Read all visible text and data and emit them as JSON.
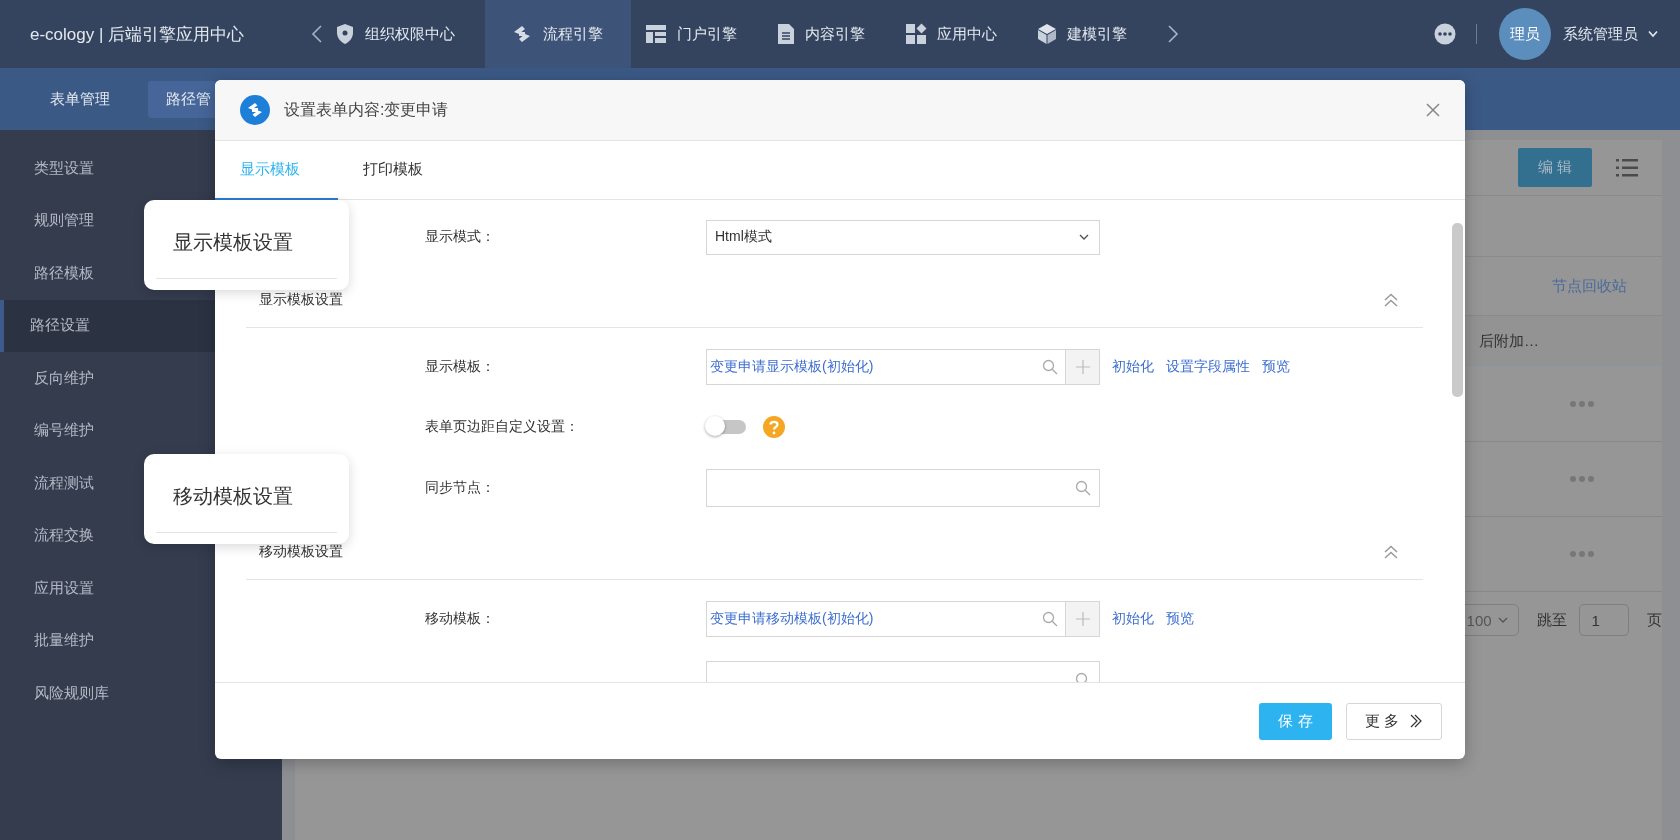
{
  "app": {
    "title": "e-cology | 后端引擎应用中心"
  },
  "top_nav": [
    {
      "label": "组织权限中心",
      "selected": false
    },
    {
      "label": "流程引擎",
      "selected": true
    },
    {
      "label": "门户引擎",
      "selected": false
    },
    {
      "label": "内容引擎",
      "selected": false
    },
    {
      "label": "应用中心",
      "selected": false
    },
    {
      "label": "建模引擎",
      "selected": false
    }
  ],
  "user": {
    "avatar_text": "理员",
    "name": "系统管理员"
  },
  "sub_nav": [
    {
      "label": "表单管理",
      "selected": false
    },
    {
      "label": "路径管",
      "selected": true
    }
  ],
  "sidebar": {
    "items": [
      {
        "label": "类型设置",
        "selected": false
      },
      {
        "label": "规则管理",
        "selected": false
      },
      {
        "label": "路径模板",
        "selected": false
      },
      {
        "label": "路径设置",
        "selected": true
      },
      {
        "label": "反向维护",
        "selected": false
      },
      {
        "label": "编号维护",
        "selected": false
      },
      {
        "label": "流程测试",
        "selected": false
      },
      {
        "label": "流程交换",
        "selected": false
      },
      {
        "label": "应用设置",
        "selected": false
      },
      {
        "label": "批量维护",
        "selected": false
      },
      {
        "label": "风险规则库",
        "selected": false
      }
    ]
  },
  "background_page": {
    "edit_button": "编 辑",
    "recycle_link": "节点回收站",
    "column_header": "后附加…",
    "pagination": {
      "page_size": "100",
      "jump_label": "跳至",
      "page_value": "1",
      "page_suffix": "页"
    }
  },
  "dialog": {
    "title": "设置表单内容:变更申请",
    "tabs": [
      {
        "label": "显示模板",
        "selected": true
      },
      {
        "label": "打印模板",
        "selected": false
      }
    ],
    "rows": [
      {
        "kind": "select",
        "label": "显示模式：",
        "value": "Html模式"
      },
      {
        "kind": "section",
        "title": "显示模板设置",
        "expanded": true
      },
      {
        "kind": "browse",
        "label": "显示模板：",
        "value": "变更申请显示模板(初始化)",
        "links": [
          "初始化",
          "设置字段属性",
          "预览"
        ]
      },
      {
        "kind": "toggle",
        "label": "表单页边距自定义设置：",
        "on": false
      },
      {
        "kind": "search",
        "label": "同步节点："
      },
      {
        "kind": "section",
        "title": "移动模板设置",
        "expanded": true
      },
      {
        "kind": "browse",
        "label": "移动模板：",
        "value": "变更申请移动模板(初始化)",
        "links": [
          "初始化",
          "预览"
        ]
      },
      {
        "kind": "search"
      }
    ],
    "buttons": [
      {
        "kind": "primary",
        "label": "保 存"
      },
      {
        "kind": "more",
        "label": "更 多"
      }
    ]
  },
  "callouts": [
    {
      "text": "显示模板设置"
    },
    {
      "text": "移动模板设置"
    }
  ]
}
